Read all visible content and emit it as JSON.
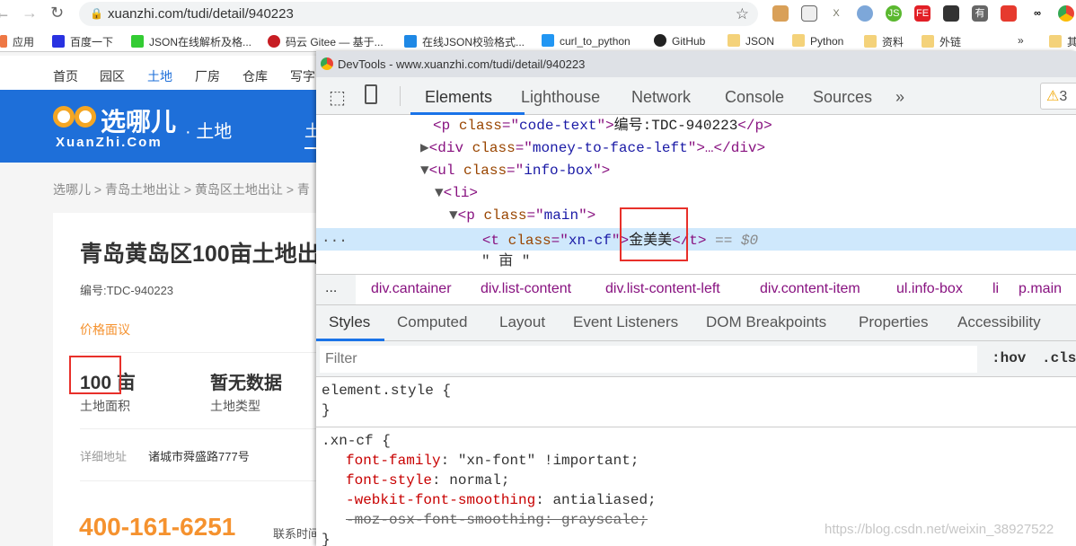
{
  "browser": {
    "url": "xuanzhi.com/tudi/detail/940223",
    "bookmarks": [
      "应用",
      "百度一下",
      "JSON在线解析及格...",
      "码云 Gitee — 基于...",
      "在线JSON校验格式...",
      "curl_to_python",
      "GitHub",
      "JSON",
      "Python",
      "资料",
      "外链",
      "其"
    ],
    "overflow": "»",
    "extensions": [
      "cookie-icon",
      "document-icon",
      "x-icon",
      "o-icon",
      "js-toggle-icon",
      "fe-icon",
      "spy-icon",
      "you-icon",
      "red-icon",
      "link-icon",
      "chrome-icon"
    ]
  },
  "site": {
    "nav": [
      "首页",
      "园区",
      "土地",
      "厂房",
      "仓库",
      "写字"
    ],
    "active_nav": "土地",
    "logo": "选哪儿",
    "logo_sub": "XuanZhi.Com",
    "section": "· 土地",
    "section_tab": "土",
    "breadcrumb": [
      "选哪儿",
      "青岛土地出让",
      "黄岛区土地出让",
      "青"
    ],
    "breadcrumb_sep": ">",
    "title": "青岛黄岛区100亩土地出",
    "code": "编号:TDC-940223",
    "price": "价格面议",
    "area_value": "100",
    "area_unit": "亩",
    "area_label": "土地面积",
    "type_value": "暂无数据",
    "type_label": "土地类型",
    "address_label": "详细地址",
    "address_value": "诸城市舜盛路777号",
    "phone": "400-161-6251",
    "contact_label": "联系时间",
    "brand_color": "#1e6fd9",
    "accent_color": "#f5922f"
  },
  "devtools": {
    "title": "DevTools - www.xuanzhi.com/tudi/detail/940223",
    "tabs": [
      "Elements",
      "Lighthouse",
      "Network",
      "Console",
      "Sources",
      "»"
    ],
    "active_tab": "Elements",
    "warnings": "3",
    "dom": {
      "l1_tag": "p",
      "l1_class": "code-text",
      "l1_text": "编号:TDC-940223",
      "l2_tag": "div",
      "l2_class": "money-to-face-left",
      "l3_tag": "ul",
      "l3_class": "info-box",
      "l4_tag": "li",
      "l5_tag": "p",
      "l5_class": "main",
      "l6_tag": "t",
      "l6_class": "xn-cf",
      "l6_text": "金美美",
      "l6_suffix": "== $0",
      "l7_text": "\" 亩 \""
    },
    "breadcrumb": [
      "div.cantainer",
      "div.list-content",
      "div.list-content-left",
      "div.content-item",
      "ul.info-box",
      "li",
      "p.main"
    ],
    "styles_tabs": [
      "Styles",
      "Computed",
      "Layout",
      "Event Listeners",
      "DOM Breakpoints",
      "Properties",
      "Accessibility"
    ],
    "filter_placeholder": "Filter",
    "hov": ":hov",
    "cls": ".cls",
    "rules": {
      "element_style": "element.style {",
      "close": "}",
      "selector": ".xn-cf {",
      "decls": [
        {
          "p": "font-family",
          "v": "\"xn-font\" !important;"
        },
        {
          "p": "font-style",
          "v": "normal;"
        },
        {
          "p": "-webkit-font-smoothing",
          "v": "antialiased;"
        },
        {
          "p": "-moz-osx-font-smoothing",
          "v": "grayscale;",
          "struck": true
        }
      ]
    }
  },
  "watermark": "https://blog.csdn.net/weixin_38927522"
}
